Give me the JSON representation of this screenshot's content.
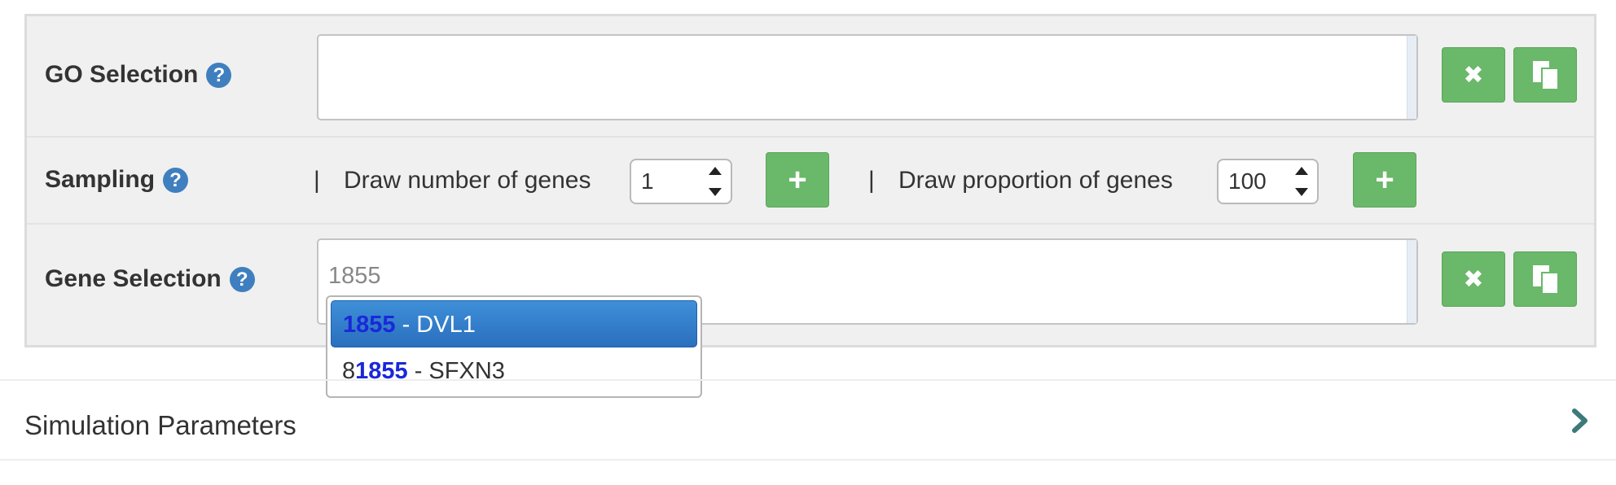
{
  "go_selection": {
    "label": "GO Selection",
    "help_glyph": "?",
    "input_value": "",
    "clear_icon": "close-icon",
    "copy_icon": "copy-icon"
  },
  "sampling": {
    "label": "Sampling",
    "help_glyph": "?",
    "separator": "|",
    "draw_number_label": "Draw number of genes",
    "draw_number_value": "1",
    "draw_proportion_label": "Draw proportion of genes",
    "draw_proportion_value": "100",
    "add_glyph": "+"
  },
  "gene_selection": {
    "label": "Gene Selection",
    "help_glyph": "?",
    "input_value": "1855",
    "suggestions": [
      {
        "prefix": "",
        "match": "1855",
        "suffix": " - DVL1",
        "active": true
      },
      {
        "prefix": "8",
        "match": "1855",
        "suffix": " - SFXN3",
        "active": false
      }
    ]
  },
  "simulation_parameters": {
    "title": "Simulation Parameters"
  },
  "colors": {
    "accent_green": "#6ab86a",
    "help_blue": "#3f7fbf",
    "highlight_blue": "#1a28d8",
    "active_item": "#2a6fbf"
  }
}
